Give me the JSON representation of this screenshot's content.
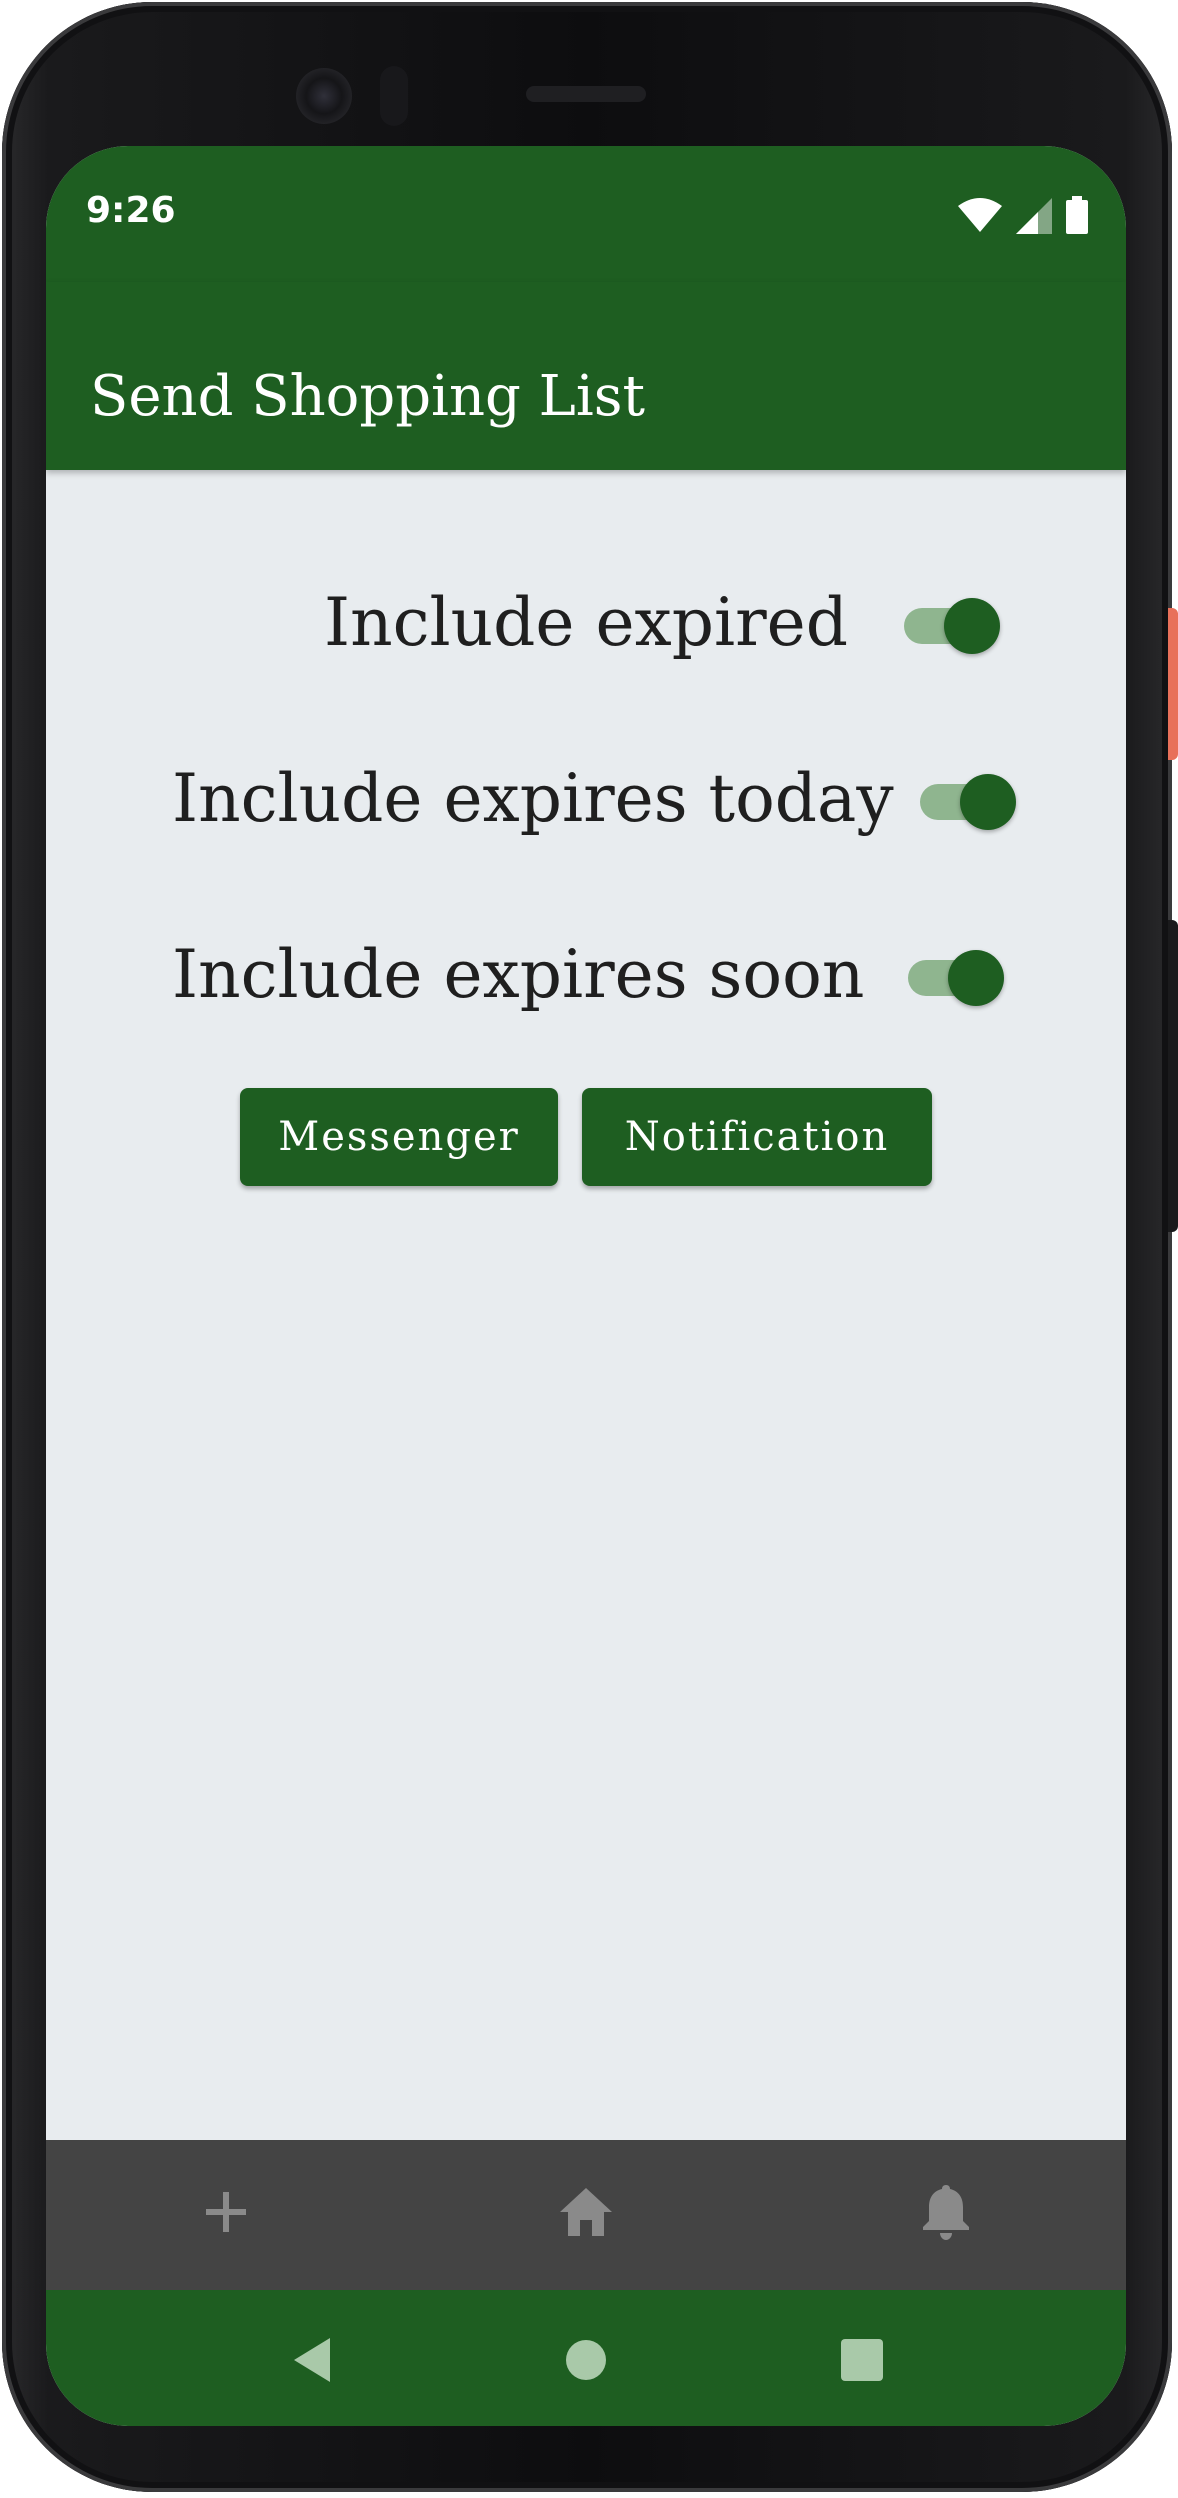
{
  "status_bar": {
    "time": "9:26",
    "icons": [
      "wifi-icon",
      "signal-icon",
      "battery-icon"
    ]
  },
  "app_bar": {
    "title": "Send Shopping List"
  },
  "toggles": [
    {
      "label": "Include expired",
      "checked": true
    },
    {
      "label": "Include expires today",
      "checked": true
    },
    {
      "label": "Include expires soon",
      "checked": true
    }
  ],
  "buttons": {
    "messenger": "Messenger",
    "notification": "Notification"
  },
  "bottom_nav": {
    "items": [
      "add-icon",
      "home-icon",
      "bell-icon"
    ]
  },
  "system_nav": {
    "items": [
      "back-icon",
      "home-circle-icon",
      "recents-icon"
    ]
  },
  "colors": {
    "primary": "#1e5e21",
    "switch_track": "#8fb58f",
    "background": "#e8ecef",
    "bottom_nav": "#444444"
  }
}
